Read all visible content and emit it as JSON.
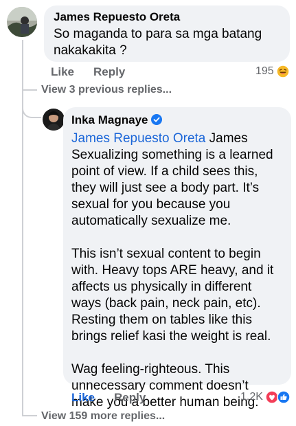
{
  "comment1": {
    "author": "James Repuesto Oreta",
    "text": "So maganda to para sa mga batang nakakakita ?",
    "like_label": "Like",
    "reply_label": "Reply",
    "reaction_count": "195",
    "reaction_icon": "laugh-emoji-icon"
  },
  "view_previous": "View 3 previous replies...",
  "reply1": {
    "author": "Inka Magnaye",
    "verified": true,
    "mention": "James Repuesto Oreta",
    "para1_rest": " James Sexualizing something is a learned point of view. If a child sees this, they will just see a body part. It’s sexual for you because you automatically sexualize me.",
    "para2": "This isn’t sexual content to begin with. Heavy tops ARE heavy, and it affects us physically in different ways (back pain, neck pain, etc). Resting them on tables like this brings relief kasi the weight is real.",
    "para3": "Wag feeling-righteous. This unnecessary comment doesn’t make you a better human being.",
    "like_label": "Like",
    "reply_label": "Reply",
    "reaction_count": "1.2K",
    "reaction_icons": [
      "heart-reaction-icon",
      "like-reaction-icon"
    ]
  },
  "view_more": "View 159 more replies...",
  "colors": {
    "link_blue": "#1b66d8",
    "bubble_bg": "#f0f2f5",
    "muted": "#65676b",
    "heart_red": "#f33e58",
    "like_blue": "#1877f2"
  }
}
